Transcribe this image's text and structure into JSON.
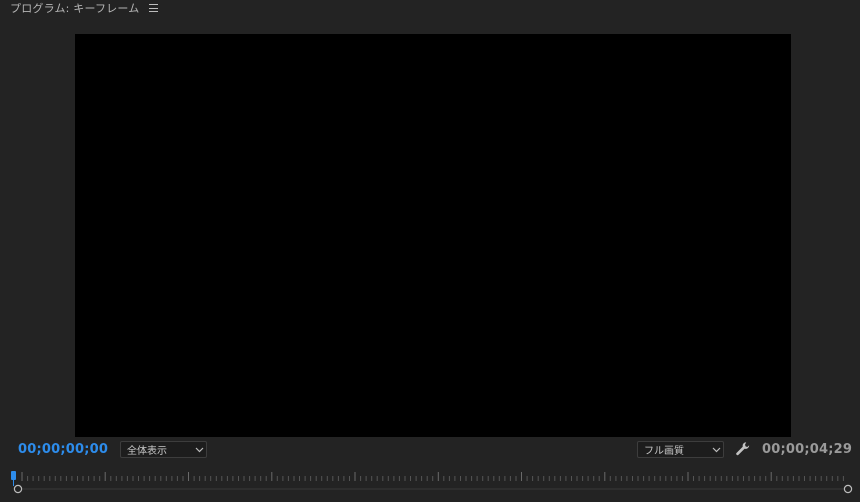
{
  "panel": {
    "title": "プログラム: キーフレーム",
    "menu_icon": "hamburger-menu-icon"
  },
  "controls": {
    "current_timecode": "00;00;00;00",
    "zoom_select": "全体表示",
    "quality_select": "フル画質",
    "settings_icon": "wrench-icon",
    "duration_timecode": "00;00;04;29"
  },
  "colors": {
    "panel_bg": "#232323",
    "viewer_bg": "#000000",
    "accent_blue": "#2d8ceb",
    "text_muted": "#9a9a9a"
  },
  "playhead_position": 0
}
